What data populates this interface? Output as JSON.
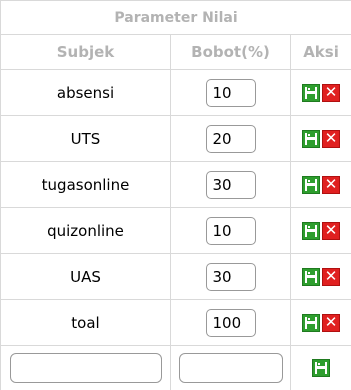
{
  "table": {
    "title": "Parameter Nilai",
    "headers": {
      "subject": "Subjek",
      "weight": "Bobot(%)",
      "action": "Aksi"
    },
    "rows": [
      {
        "subject": "absensi",
        "weight": "10"
      },
      {
        "subject": "UTS",
        "weight": "20"
      },
      {
        "subject": "tugasonline",
        "weight": "30"
      },
      {
        "subject": "quizonline",
        "weight": "10"
      },
      {
        "subject": "UAS",
        "weight": "30"
      },
      {
        "subject": "toal",
        "weight": "100"
      }
    ],
    "new_row": {
      "subject_value": "",
      "weight_value": ""
    }
  },
  "icons": {
    "save": "floppy-disk-icon",
    "delete": "x-icon"
  },
  "colors": {
    "save_green": "#2e9e2e",
    "delete_red": "#e02020",
    "header_gray": "#b3b3b3"
  }
}
